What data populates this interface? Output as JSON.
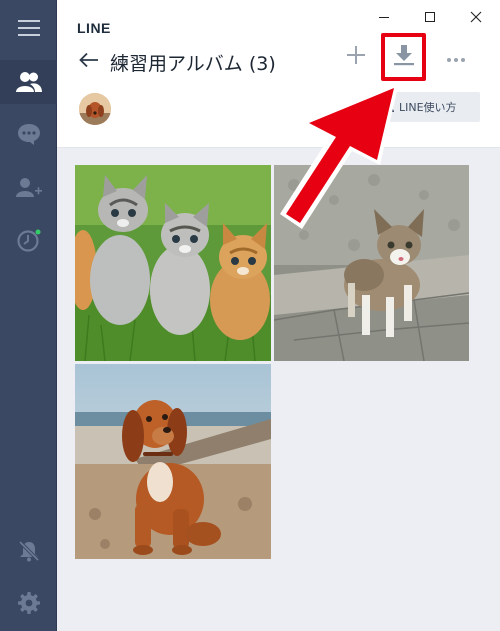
{
  "app": {
    "name": "LINE"
  },
  "sidebar": {
    "items": [
      {
        "name": "menu",
        "icon": "hamburger-menu-icon"
      },
      {
        "name": "friends",
        "icon": "friends-icon"
      },
      {
        "name": "chats",
        "icon": "chat-bubble-icon"
      },
      {
        "name": "add-friend",
        "icon": "add-friend-icon"
      },
      {
        "name": "timeline",
        "icon": "clock-icon"
      }
    ],
    "bottom_items": [
      {
        "name": "notifications",
        "icon": "bell-muted-icon"
      },
      {
        "name": "settings",
        "icon": "gear-icon"
      }
    ]
  },
  "window_controls": [
    "minimize-icon",
    "maximize-icon",
    "close-icon"
  ],
  "header": {
    "title": "練習用アルバム (3)",
    "guide_label": "LINE使い方"
  },
  "toolbar": {
    "items": [
      "plus-icon",
      "download-icon",
      "more-icon"
    ],
    "highlighted": "download-icon"
  },
  "album": {
    "photos": [
      {
        "subject": "kittens-on-grass"
      },
      {
        "subject": "kitten-on-pavement"
      },
      {
        "subject": "puppy-on-beach"
      }
    ]
  },
  "colors": {
    "sidebar": "#3b4864",
    "accent_red": "#e60012",
    "gallery_bg": "#eceef3",
    "notification_dot": "#33cc66"
  }
}
